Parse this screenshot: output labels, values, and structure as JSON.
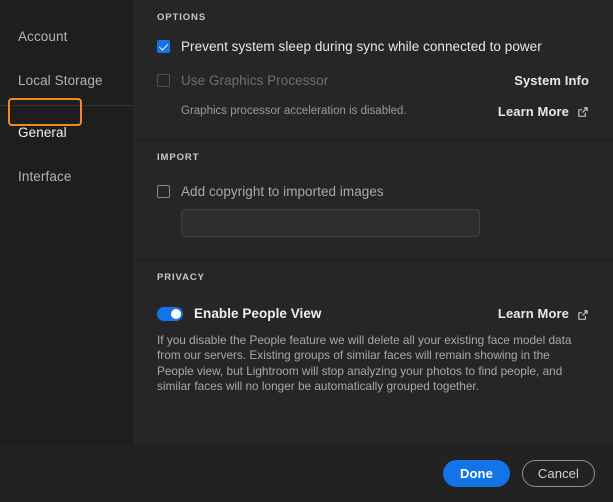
{
  "sidebar": {
    "items": [
      {
        "label": "Account",
        "selected": false
      },
      {
        "label": "Local Storage",
        "selected": false
      },
      {
        "label": "General",
        "selected": true
      },
      {
        "label": "Interface",
        "selected": false
      }
    ]
  },
  "options": {
    "title": "OPTIONS",
    "prevent_sleep": {
      "label": "Prevent system sleep during sync while connected to power",
      "checked": true
    },
    "use_gpu": {
      "label": "Use Graphics Processor",
      "checked": false,
      "disabled": true,
      "helper": "Graphics processor acceleration is disabled."
    },
    "system_info_label": "System Info",
    "learn_more_label": "Learn More"
  },
  "import": {
    "title": "IMPORT",
    "add_copyright": {
      "label": "Add copyright to imported images",
      "checked": false
    },
    "copyright_value": "",
    "copyright_placeholder": ""
  },
  "privacy": {
    "title": "PRIVACY",
    "people_view": {
      "label": "Enable People View",
      "enabled": true
    },
    "learn_more_label": "Learn More",
    "description": "If you disable the People feature we will delete all your existing face model data from our servers. Existing groups of similar faces will remain showing in the People view, but Lightroom will stop analyzing your photos to find people, and similar faces will no longer be automatically grouped together."
  },
  "footer": {
    "done_label": "Done",
    "cancel_label": "Cancel"
  },
  "colors": {
    "accent_blue": "#1473e6",
    "focus_orange": "#f08b22",
    "panel_bg": "#262626",
    "sidebar_bg": "#1e1e1e",
    "footer_bg": "#222222"
  }
}
